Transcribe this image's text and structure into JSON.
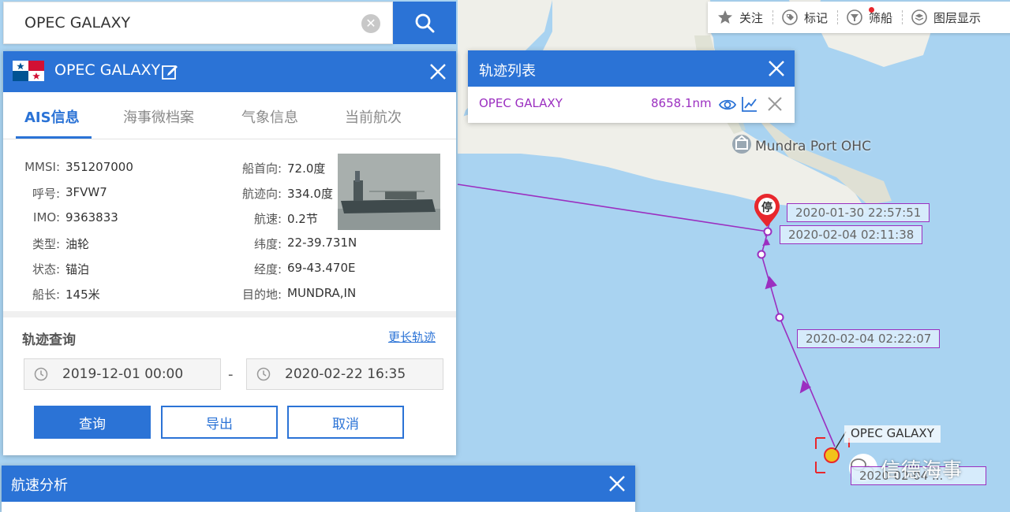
{
  "search": {
    "value": "OPEC GALAXY"
  },
  "toolbar": {
    "items": [
      {
        "label": "关注",
        "icon": "star-icon"
      },
      {
        "label": "标记",
        "icon": "tag-icon"
      },
      {
        "label": "筛船",
        "icon": "filter-icon"
      },
      {
        "label": "图层显示",
        "icon": "layers-icon"
      }
    ]
  },
  "ship_panel": {
    "ship_name": "OPEC GALAXY",
    "flag": "panama-flag",
    "tabs": [
      "AIS信息",
      "海事微档案",
      "气象信息",
      "当前航次"
    ],
    "active_tab": 0,
    "left_fields": [
      {
        "label": "MMSI:",
        "value": "351207000"
      },
      {
        "label": "呼号:",
        "value": "3FVW7"
      },
      {
        "label": "IMO:",
        "value": "9363833"
      },
      {
        "label": "类型:",
        "value": "油轮"
      },
      {
        "label": "状态:",
        "value": "锚泊"
      },
      {
        "label": "船长:",
        "value": "145米"
      }
    ],
    "right_fields": [
      {
        "label": "船首向:",
        "value": "72.0度"
      },
      {
        "label": "航迹向:",
        "value": "334.0度"
      },
      {
        "label": "航速:",
        "value": "0.2节"
      },
      {
        "label": "纬度:",
        "value": "22-39.731N"
      },
      {
        "label": "经度:",
        "value": "69-43.470E"
      },
      {
        "label": "目的地:",
        "value": "MUNDRA,IN"
      }
    ]
  },
  "track_query": {
    "title": "轨迹查询",
    "longer_link": "更长轨迹",
    "start_date": "2019-12-01 00:00",
    "separator": "-",
    "end_date": "2020-02-22 16:35",
    "buttons": {
      "query": "查询",
      "export": "导出",
      "cancel": "取消"
    }
  },
  "track_list": {
    "title": "轨迹列表",
    "rows": [
      {
        "name": "OPEC GALAXY",
        "distance": "8658.1nm"
      }
    ]
  },
  "speed_panel": {
    "title": "航速分析"
  },
  "map": {
    "port_name": "Mundra Port OHC",
    "stop_marker": "停",
    "track_labels": [
      "2020-01-30 22:57:51",
      "2020-02-04 02:11:38",
      "2020-02-04 02:22:07",
      "2020-02-04 ..."
    ],
    "ship_label": "OPEC GALAXY",
    "watermark": "信德海事",
    "colors": {
      "track": "#9b2fc0",
      "water": "#a9d3f1",
      "land": "#efefe9",
      "accent": "#2b73d6",
      "stop_pin": "#e8272d"
    }
  }
}
